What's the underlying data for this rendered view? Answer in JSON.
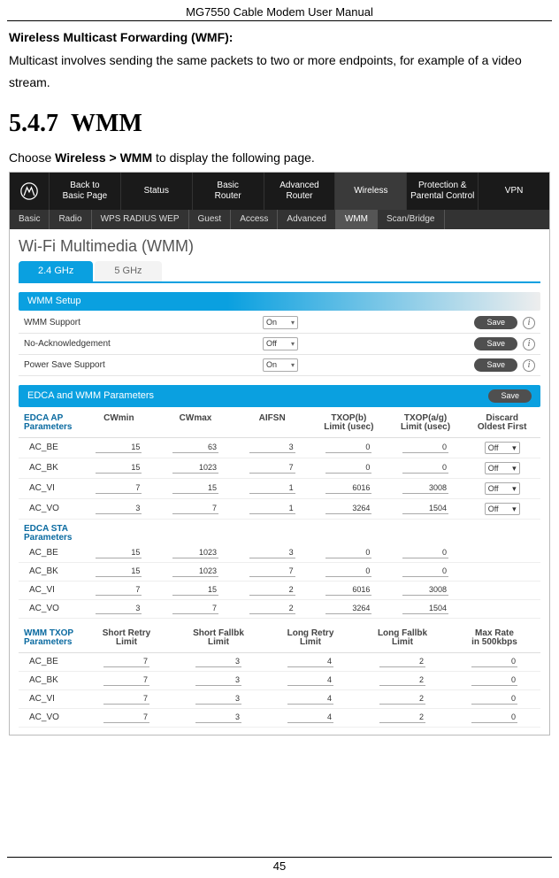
{
  "doc": {
    "header": "MG7550 Cable Modem User Manual",
    "page_number": "45",
    "wmf_heading": "Wireless Multicast Forwarding (WMF):",
    "wmf_para": "Multicast involves sending the same packets to two or more endpoints, for example of a video stream.",
    "section_no": "5.4.7",
    "section_title": "WMM",
    "choose_prefix": "Choose ",
    "choose_bold": "Wireless > WMM",
    "choose_suffix": " to display the following page."
  },
  "ui": {
    "topnav": [
      "Back to\nBasic Page",
      "Status",
      "Basic\nRouter",
      "Advanced\nRouter",
      "Wireless",
      "Protection &\nParental Control",
      "VPN"
    ],
    "topnav_active": 4,
    "subnav": [
      "Basic",
      "Radio",
      "WPS RADIUS WEP",
      "Guest",
      "Access",
      "Advanced",
      "WMM",
      "Scan/Bridge"
    ],
    "subnav_active": 6,
    "page_title": "Wi-Fi Multimedia (WMM)",
    "tabs": [
      "2.4 GHz",
      "5 GHz"
    ],
    "tab_active": 0,
    "save_label": "Save",
    "info_glyph": "i",
    "wmm_setup_title": "WMM Setup",
    "wmm_setup": [
      {
        "label": "WMM Support",
        "value": "On"
      },
      {
        "label": "No-Acknowledgement",
        "value": "Off"
      },
      {
        "label": "Power Save Support",
        "value": "On"
      }
    ],
    "edca_title": "EDCA and WMM Parameters",
    "edca_ap_label": "EDCA AP\nParameters",
    "edca_sta_label": "EDCA STA\nParameters",
    "edca_headers": [
      "CWmin",
      "CWmax",
      "AIFSN",
      "TXOP(b)\nLimit (usec)",
      "TXOP(a/g)\nLimit (usec)",
      "Discard\nOldest First"
    ],
    "edca_ap_rows": [
      {
        "name": "AC_BE",
        "v": [
          "15",
          "63",
          "3",
          "0",
          "0"
        ],
        "d": "Off"
      },
      {
        "name": "AC_BK",
        "v": [
          "15",
          "1023",
          "7",
          "0",
          "0"
        ],
        "d": "Off"
      },
      {
        "name": "AC_VI",
        "v": [
          "7",
          "15",
          "1",
          "6016",
          "3008"
        ],
        "d": "Off"
      },
      {
        "name": "AC_VO",
        "v": [
          "3",
          "7",
          "1",
          "3264",
          "1504"
        ],
        "d": "Off"
      }
    ],
    "edca_sta_rows": [
      {
        "name": "AC_BE",
        "v": [
          "15",
          "1023",
          "3",
          "0",
          "0"
        ]
      },
      {
        "name": "AC_BK",
        "v": [
          "15",
          "1023",
          "7",
          "0",
          "0"
        ]
      },
      {
        "name": "AC_VI",
        "v": [
          "7",
          "15",
          "2",
          "6016",
          "3008"
        ]
      },
      {
        "name": "AC_VO",
        "v": [
          "3",
          "7",
          "2",
          "3264",
          "1504"
        ]
      }
    ],
    "txop_label": "WMM TXOP\nParameters",
    "txop_headers": [
      "Short Retry\nLimit",
      "Short Fallbk\nLimit",
      "Long Retry\nLimit",
      "Long Fallbk\nLimit",
      "Max Rate\nin 500kbps"
    ],
    "txop_rows": [
      {
        "name": "AC_BE",
        "v": [
          "7",
          "3",
          "4",
          "2",
          "0"
        ]
      },
      {
        "name": "AC_BK",
        "v": [
          "7",
          "3",
          "4",
          "2",
          "0"
        ]
      },
      {
        "name": "AC_VI",
        "v": [
          "7",
          "3",
          "4",
          "2",
          "0"
        ]
      },
      {
        "name": "AC_VO",
        "v": [
          "7",
          "3",
          "4",
          "2",
          "0"
        ]
      }
    ]
  }
}
